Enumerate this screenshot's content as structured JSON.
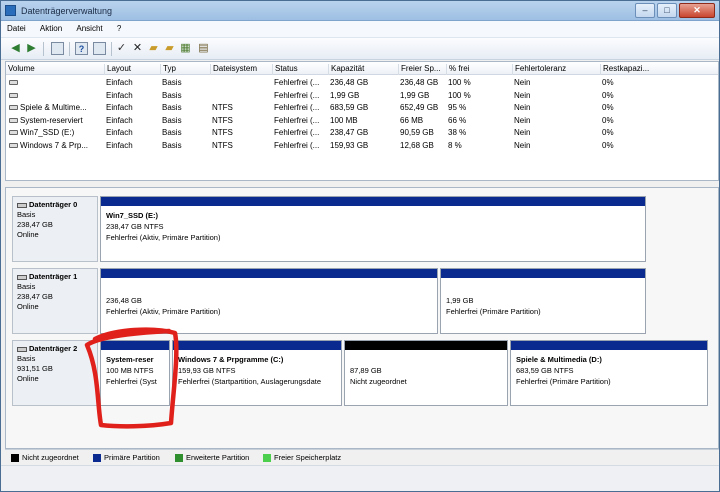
{
  "window": {
    "title": "Datenträgerverwaltung",
    "min": "–",
    "max": "□",
    "close": "✕"
  },
  "menu": [
    "Datei",
    "Aktion",
    "Ansicht",
    "?"
  ],
  "toolbar_icons": [
    "back-arrow-icon",
    "forward-arrow-icon",
    "console-tree-icon",
    "help-icon",
    "properties-icon",
    "delete-icon",
    "checkmark-icon",
    "open-folder-icon",
    "export-icon",
    "view-icon"
  ],
  "volume_table": {
    "headers": [
      "Volume",
      "Layout",
      "Typ",
      "Dateisystem",
      "Status",
      "Kapazität",
      "Freier Sp...",
      "% frei",
      "Fehlertoleranz",
      "Restkapazi..."
    ],
    "rows": [
      [
        "",
        "Einfach",
        "Basis",
        "",
        "Fehlerfrei (...",
        "236,48 GB",
        "236,48 GB",
        "100 %",
        "Nein",
        "0%"
      ],
      [
        "",
        "Einfach",
        "Basis",
        "",
        "Fehlerfrei (...",
        "1,99 GB",
        "1,99 GB",
        "100 %",
        "Nein",
        "0%"
      ],
      [
        "Spiele & Multime...",
        "Einfach",
        "Basis",
        "NTFS",
        "Fehlerfrei (...",
        "683,59 GB",
        "652,49 GB",
        "95 %",
        "Nein",
        "0%"
      ],
      [
        "System-reserviert",
        "Einfach",
        "Basis",
        "NTFS",
        "Fehlerfrei (...",
        "100 MB",
        "66 MB",
        "66 %",
        "Nein",
        "0%"
      ],
      [
        "Win7_SSD (E:)",
        "Einfach",
        "Basis",
        "NTFS",
        "Fehlerfrei (...",
        "238,47 GB",
        "90,59 GB",
        "38 %",
        "Nein",
        "0%"
      ],
      [
        "Windows 7 & Prp...",
        "Einfach",
        "Basis",
        "NTFS",
        "Fehlerfrei (...",
        "159,93 GB",
        "12,68 GB",
        "8 %",
        "Nein",
        "0%"
      ]
    ]
  },
  "disks": [
    {
      "name": "Datenträger 0",
      "type": "Basis",
      "size": "238,47 GB",
      "state": "Online",
      "partitions": [
        {
          "name": "Win7_SSD  (E:)",
          "size": "238,47 GB NTFS",
          "status": "Fehlerfrei (Aktiv, Primäre Partition)",
          "kind": "primary"
        }
      ]
    },
    {
      "name": "Datenträger 1",
      "type": "Basis",
      "size": "238,47 GB",
      "state": "Online",
      "partitions": [
        {
          "name": "",
          "size": "236,48 GB",
          "status": "Fehlerfrei (Aktiv, Primäre Partition)",
          "kind": "primary"
        },
        {
          "name": "",
          "size": "1,99 GB",
          "status": "Fehlerfrei (Primäre Partition)",
          "kind": "primary"
        }
      ]
    },
    {
      "name": "Datenträger 2",
      "type": "Basis",
      "size": "931,51 GB",
      "state": "Online",
      "partitions": [
        {
          "name": "System-reser",
          "size": "100 MB NTFS",
          "status": "Fehlerfrei (Syst",
          "kind": "primary"
        },
        {
          "name": "Windows 7 & Prpgramme  (C:)",
          "size": "159,93 GB NTFS",
          "status": "Fehlerfrei (Startpartition, Auslagerungsdate",
          "kind": "primary"
        },
        {
          "name": "",
          "size": "87,89 GB",
          "status": "Nicht zugeordnet",
          "kind": "unallocated"
        },
        {
          "name": "Spiele & Multimedia  (D:)",
          "size": "683,59 GB NTFS",
          "status": "Fehlerfrei (Primäre Partition)",
          "kind": "primary"
        }
      ]
    }
  ],
  "legend": [
    {
      "label": "Nicht zugeordnet",
      "color": "#000000"
    },
    {
      "label": "Primäre Partition",
      "color": "#0b2a8f"
    },
    {
      "label": "Erweiterte Partition",
      "color": "#2f8f2f"
    },
    {
      "label": "Freier Speicherplatz",
      "color": "#4ccf4c"
    }
  ],
  "colors": {
    "primary_bar": "#0b2a8f",
    "unallocated_bar": "#000000",
    "annotation": "#e0201a"
  }
}
